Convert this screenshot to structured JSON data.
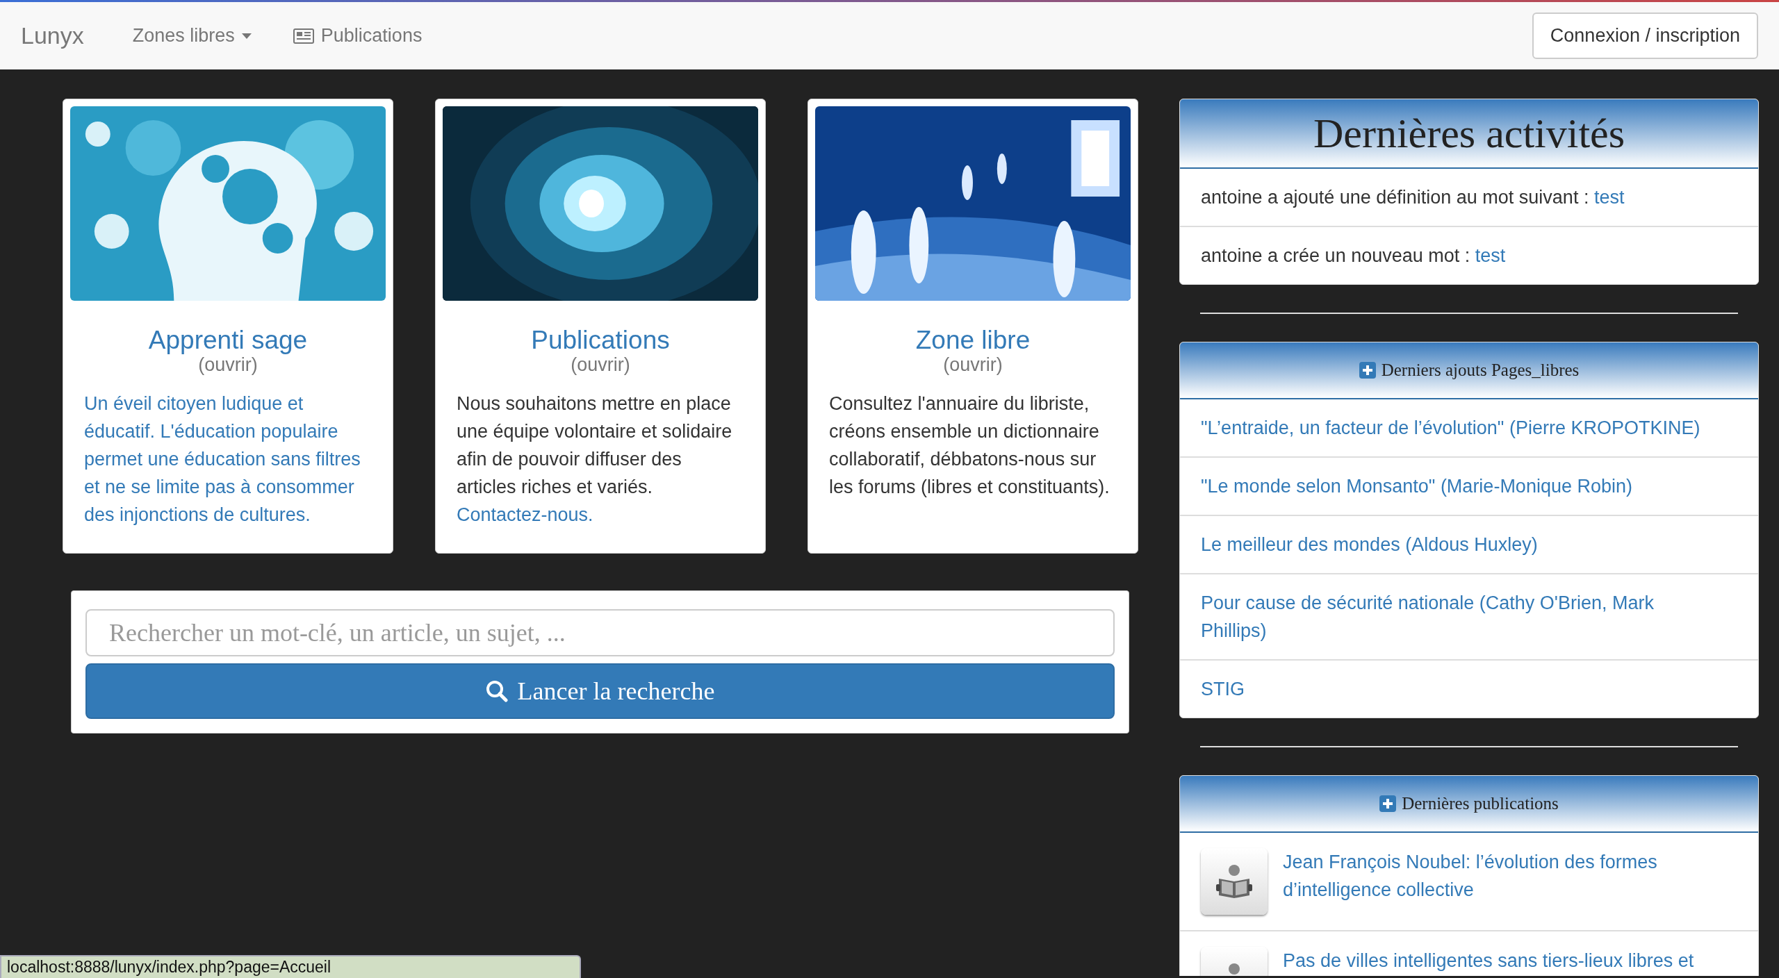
{
  "navbar": {
    "brand": "Lunyx",
    "menu": [
      {
        "kind": "dropdown",
        "label": "Zones libres"
      },
      {
        "kind": "icon",
        "label": "Publications"
      }
    ],
    "login_button": "Connexion / inscription"
  },
  "cards": [
    {
      "kind": "picture",
      "title": "Apprenti sage",
      "subtitle": "(ouvrir)",
      "link": "Un éveil citoyen ludique et éducatif. L'éducation populaire permet une éducation sans filtres et ne se limite pas à consommer des injonctions de cultures."
    },
    {
      "kind": "picture",
      "title": "Publications",
      "subtitle": "(ouvrir)",
      "text": "Nous souhaitons mettre en place une équipe volontaire et solidaire afin de pouvoir diffuser des articles riches et variés.",
      "link": "Contactez-nous."
    },
    {
      "kind": "picture",
      "title": "Zone libre",
      "subtitle": "(ouvrir)",
      "text": "Consultez l'annuaire du libriste, créons ensemble un dictionnaire collaboratif, débbatons-nous sur les forums (libres et constituants)."
    }
  ],
  "search": {
    "placeholder": "Rechercher un mot-clé, un article, un sujet, ...",
    "button": "Lancer la recherche"
  },
  "panels": [
    {
      "kind": "title",
      "heading": "Dernières activités",
      "items": [
        {
          "text": "antoine a ajouté une définition au mot suivant :",
          "link": "test"
        },
        {
          "text": "antoine a crée un nouveau mot :",
          "link": "test"
        }
      ]
    },
    {
      "kind": "section",
      "heading": "Derniers ajouts Pages_libres",
      "items": [
        {
          "link": "\"L’entraide, un facteur de l’évolution\" (Pierre KROPOTKINE)"
        },
        {
          "link": "\"Le monde selon Monsanto\" (Marie-Monique Robin)"
        },
        {
          "link": "Le meilleur des mondes (Aldous Huxley)"
        },
        {
          "link": "Pour cause de sécurité nationale (Cathy O'Brien, Mark Phillips)"
        },
        {
          "link": "STIG"
        }
      ]
    },
    {
      "kind": "section",
      "heading": "Dernières publications",
      "items": [
        {
          "thumb": true,
          "link": "Jean François Noubel: l’évolution des formes d’intelligence collective"
        },
        {
          "thumb": true,
          "link": "Pas de villes intelligentes sans tiers-lieux libres et"
        }
      ]
    }
  ],
  "status_url": "localhost:8888/lunyx/index.php?page=Accueil"
}
